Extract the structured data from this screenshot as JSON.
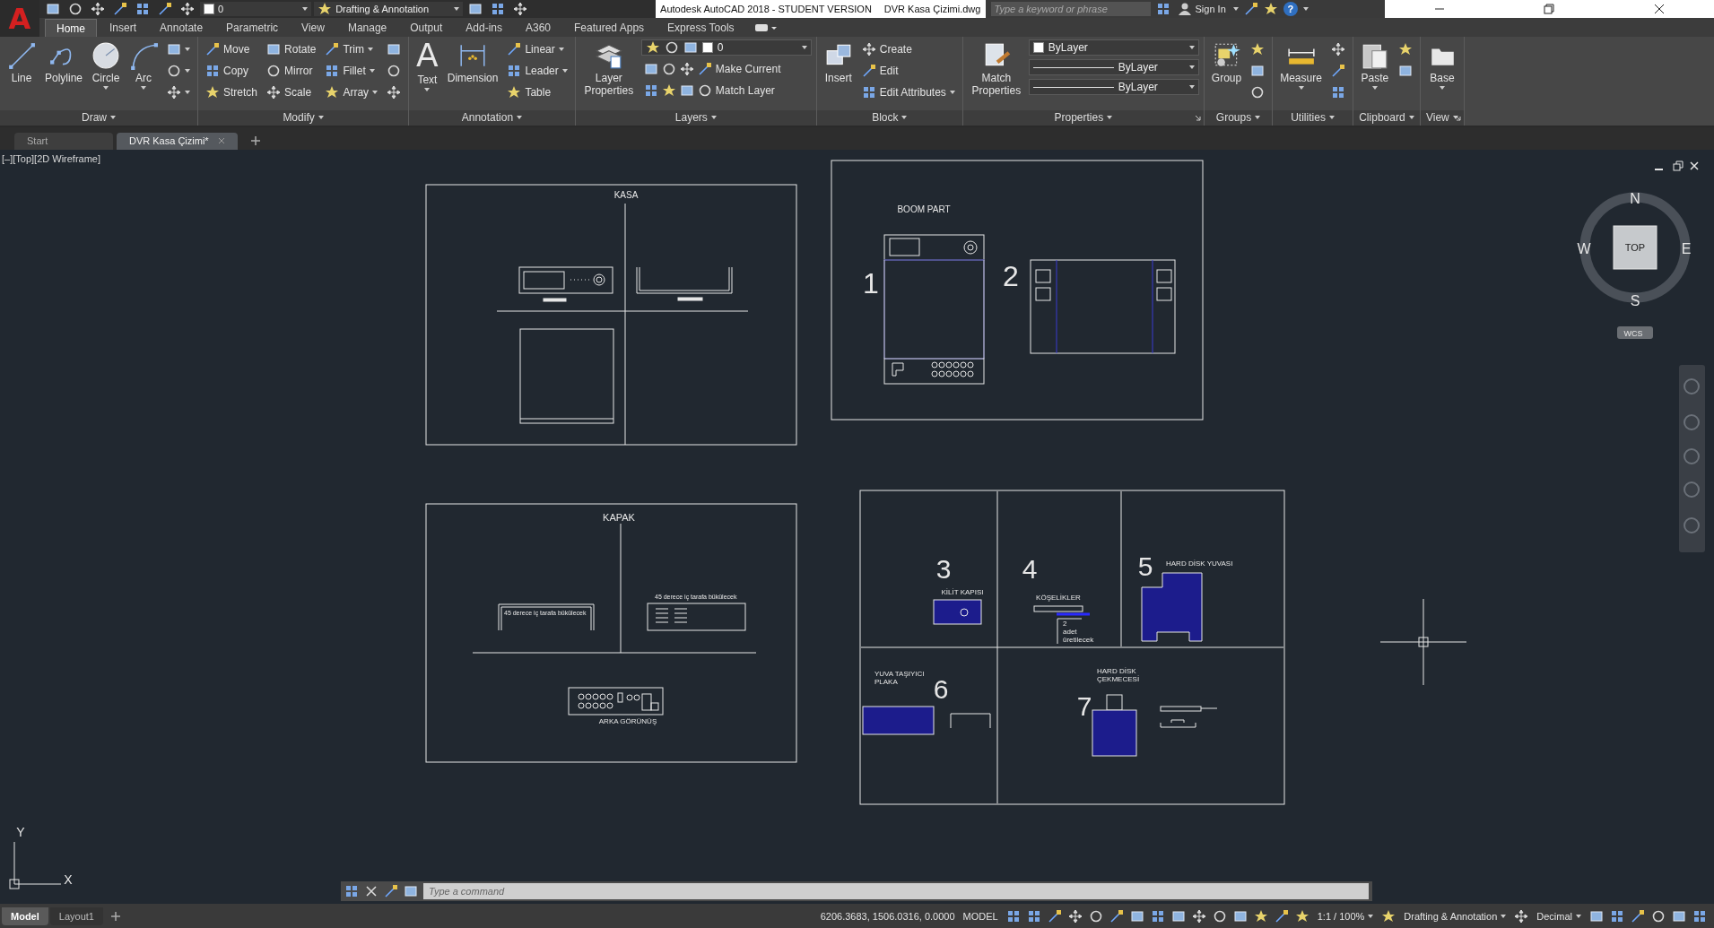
{
  "app": {
    "logo": "A",
    "title": "Autodesk AutoCAD 2018 - STUDENT VERSION",
    "file": "DVR Kasa Çizimi.dwg"
  },
  "quick_access": {
    "layer": "0",
    "workspace": "Drafting & Annotation"
  },
  "search": {
    "placeholder": "Type a keyword or phrase"
  },
  "account": {
    "sign_in": "Sign In",
    "help": "?"
  },
  "ribbon_tabs": [
    {
      "label": "Home",
      "selected": true
    },
    {
      "label": "Insert",
      "selected": false
    },
    {
      "label": "Annotate",
      "selected": false
    },
    {
      "label": "Parametric",
      "selected": false
    },
    {
      "label": "View",
      "selected": false
    },
    {
      "label": "Manage",
      "selected": false
    },
    {
      "label": "Output",
      "selected": false
    },
    {
      "label": "Add-ins",
      "selected": false
    },
    {
      "label": "A360",
      "selected": false
    },
    {
      "label": "Featured Apps",
      "selected": false
    },
    {
      "label": "Express Tools",
      "selected": false
    }
  ],
  "ribbon_panels": [
    {
      "title": "Draw",
      "launcher": false,
      "columns": [
        [
          {
            "kind": "large",
            "label": "Line",
            "menu": false
          }
        ],
        [
          {
            "kind": "large",
            "label": "Polyline",
            "menu": false
          }
        ],
        [
          {
            "kind": "large",
            "label": "Circle",
            "menu": true
          }
        ],
        [
          {
            "kind": "large",
            "label": "Arc",
            "menu": true
          }
        ],
        [
          {
            "kind": "icon",
            "menu": true
          },
          {
            "kind": "icon",
            "menu": true
          },
          {
            "kind": "icon",
            "menu": true
          }
        ]
      ]
    },
    {
      "title": "Modify",
      "launcher": false,
      "columns": [
        [
          {
            "kind": "small",
            "label": "Move",
            "menu": false
          },
          {
            "kind": "small",
            "label": "Copy",
            "menu": false
          },
          {
            "kind": "small",
            "label": "Stretch",
            "menu": false
          }
        ],
        [
          {
            "kind": "small",
            "label": "Rotate",
            "menu": false
          },
          {
            "kind": "small",
            "label": "Mirror",
            "menu": false
          },
          {
            "kind": "small",
            "label": "Scale",
            "menu": false
          }
        ],
        [
          {
            "kind": "small",
            "label": "Trim",
            "menu": true
          },
          {
            "kind": "small",
            "label": "Fillet",
            "menu": true
          },
          {
            "kind": "small",
            "label": "Array",
            "menu": true
          }
        ],
        [
          {
            "kind": "icon",
            "menu": false
          },
          {
            "kind": "icon",
            "menu": false
          },
          {
            "kind": "icon",
            "menu": false
          }
        ]
      ]
    },
    {
      "title": "Annotation",
      "launcher": false,
      "columns": [
        [
          {
            "kind": "large",
            "label": "Text",
            "glyph": "A",
            "menu": true
          }
        ],
        [
          {
            "kind": "large",
            "label": "Dimension",
            "menu": false
          }
        ],
        [
          {
            "kind": "small",
            "label": "Linear",
            "menu": true
          },
          {
            "kind": "small",
            "label": "Leader",
            "menu": true
          },
          {
            "kind": "small",
            "label": "Table",
            "menu": false
          }
        ]
      ]
    },
    {
      "title": "Layers",
      "launcher": false,
      "columns": [
        [
          {
            "kind": "large",
            "label": "Layer Properties",
            "menu": false
          }
        ],
        [
          {
            "kind": "layer-combo",
            "value": "0"
          },
          {
            "kind": "tool-row",
            "label": "Make Current"
          },
          {
            "kind": "tool-row",
            "label": "Match Layer"
          }
        ]
      ]
    },
    {
      "title": "Block",
      "launcher": false,
      "columns": [
        [
          {
            "kind": "large",
            "label": "Insert",
            "menu": false
          }
        ],
        [
          {
            "kind": "small",
            "label": "Create",
            "menu": false
          },
          {
            "kind": "small",
            "label": "Edit",
            "menu": false
          },
          {
            "kind": "small",
            "label": "Edit Attributes",
            "menu": true
          }
        ]
      ]
    },
    {
      "title": "Properties",
      "launcher": true,
      "columns": [
        [
          {
            "kind": "large",
            "label": "Match Properties",
            "menu": false
          }
        ],
        [
          {
            "kind": "color-combo",
            "value": "ByLayer"
          },
          {
            "kind": "line-combo",
            "value": "ByLayer"
          },
          {
            "kind": "line-combo",
            "value": "ByLayer"
          }
        ]
      ]
    },
    {
      "title": "Groups",
      "launcher": false,
      "columns": [
        [
          {
            "kind": "large",
            "label": "Group",
            "menu": false
          }
        ],
        [
          {
            "kind": "icon",
            "menu": false
          },
          {
            "kind": "icon",
            "menu": false
          },
          {
            "kind": "icon",
            "menu": false
          }
        ]
      ]
    },
    {
      "title": "Utilities",
      "launcher": false,
      "columns": [
        [
          {
            "kind": "large",
            "label": "Measure",
            "menu": true
          }
        ],
        [
          {
            "kind": "icon",
            "menu": false
          },
          {
            "kind": "icon",
            "menu": false
          },
          {
            "kind": "icon",
            "menu": false
          }
        ]
      ]
    },
    {
      "title": "Clipboard",
      "launcher": false,
      "columns": [
        [
          {
            "kind": "large",
            "label": "Paste",
            "menu": true
          }
        ],
        [
          {
            "kind": "icon",
            "menu": false
          },
          {
            "kind": "icon",
            "menu": false
          }
        ]
      ]
    },
    {
      "title": "View",
      "launcher": true,
      "columns": [
        [
          {
            "kind": "large",
            "label": "Base",
            "menu": true
          }
        ]
      ]
    }
  ],
  "doc_tabs": [
    {
      "label": "Start",
      "selected": false,
      "closable": false
    },
    {
      "label": "DVR Kasa Çizimi*",
      "selected": true,
      "closable": true
    }
  ],
  "viewport_label": "[–][Top][2D Wireframe]",
  "sheets": [
    {
      "title": "KASA"
    },
    {
      "title": "BOOM PART",
      "parts": [
        "1",
        "2"
      ]
    },
    {
      "title": "KAPAK",
      "notes": [
        "45 derece iç tarafa bükülecek",
        "45 derece iç tarafa bükülecek"
      ],
      "caption": "ARKA GÖRÜNÜŞ"
    }
  ],
  "details": [
    {
      "number": "3",
      "label": [
        "KİLİT KAPISI"
      ]
    },
    {
      "number": "4",
      "label": [
        "KÖŞELİKLER"
      ],
      "note": [
        "2",
        "adet",
        "üretilecek"
      ]
    },
    {
      "number": "5",
      "label": [
        "HARD DİSK YUVASI"
      ]
    },
    {
      "number": "6",
      "label": [
        "YUVA TAŞIYICI",
        "PLAKA"
      ]
    },
    {
      "number": "7",
      "label": [
        "HARD DİSK",
        "ÇEKMECESİ"
      ]
    }
  ],
  "viewcube": {
    "top": "TOP",
    "north": "N",
    "south": "S",
    "east": "E",
    "west": "W",
    "wcs": "WCS"
  },
  "ucs": {
    "x": "X",
    "y": "Y"
  },
  "command": {
    "placeholder": "Type a command"
  },
  "layout_tabs": [
    {
      "label": "Model",
      "selected": true
    },
    {
      "label": "Layout1",
      "selected": false
    }
  ],
  "status": {
    "coordinates": "6206.3683, 1506.0316, 0.0000",
    "space": "MODEL",
    "scale": "1:1 / 100%",
    "workspace": "Drafting & Annotation",
    "units": "Decimal"
  }
}
